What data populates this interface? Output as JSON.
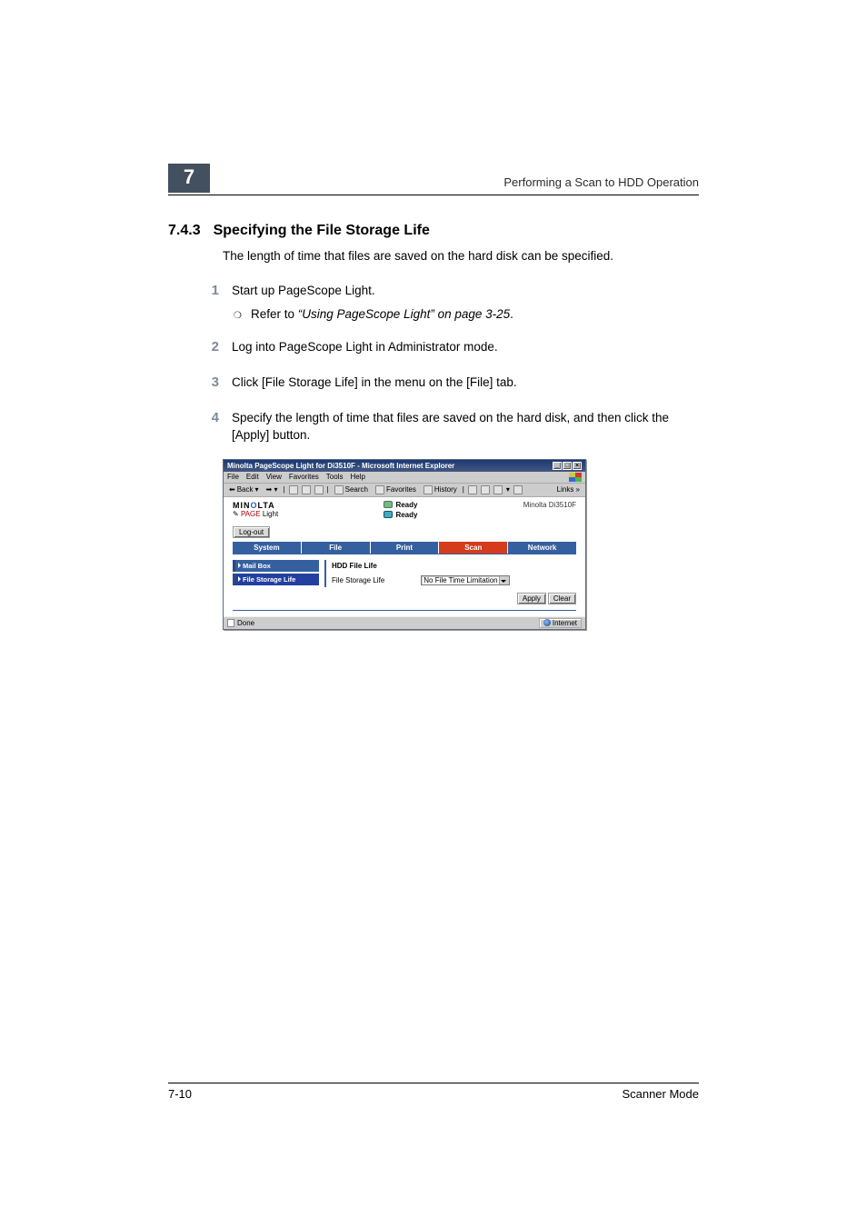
{
  "header": {
    "chapter_number": "7",
    "running_head": "Performing a Scan to HDD Operation"
  },
  "section": {
    "number": "7.4.3",
    "title": "Specifying the File Storage Life",
    "intro": "The length of time that files are saved on the hard disk can be specified."
  },
  "steps": [
    {
      "num": "1",
      "text": "Start up PageScope Light.",
      "sub": {
        "prefix": "Refer to ",
        "italic": "“Using PageScope Light” on page 3-25",
        "suffix": "."
      }
    },
    {
      "num": "2",
      "text": "Log into PageScope Light in Administrator mode."
    },
    {
      "num": "3",
      "text": "Click [File Storage Life] in the menu on the [File] tab."
    },
    {
      "num": "4",
      "text": "Specify the length of time that files are saved on the hard disk, and then click the [Apply] button."
    }
  ],
  "screenshot": {
    "window_title": "Minolta PageScope Light for Di3510F - Microsoft Internet Explorer",
    "menus": [
      "File",
      "Edit",
      "View",
      "Favorites",
      "Tools",
      "Help"
    ],
    "toolbar": {
      "back": "Back",
      "search": "Search",
      "favorites": "Favorites",
      "history": "History",
      "links": "Links"
    },
    "brand_line1": {
      "pre": "MIN",
      "mid": "O",
      "post": "LTA"
    },
    "brand_line2_pre": "PAGE",
    "brand_line2_light": "Light",
    "status1": "Ready",
    "status2": "Ready",
    "model": "Minolta Di3510F",
    "logout": "Log-out",
    "tabs": [
      "System",
      "File",
      "Print",
      "Scan",
      "Network"
    ],
    "sidebar": [
      {
        "label": "Mail Box",
        "active": false
      },
      {
        "label": "File Storage Life",
        "active": true
      }
    ],
    "panel_title": "HDD File Life",
    "form_label": "File Storage Life",
    "select_value": "No File Time Limitation",
    "apply": "Apply",
    "clear": "Clear",
    "status_done": "Done",
    "status_zone": "Internet"
  },
  "footer": {
    "left": "7-10",
    "right": "Scanner Mode"
  }
}
